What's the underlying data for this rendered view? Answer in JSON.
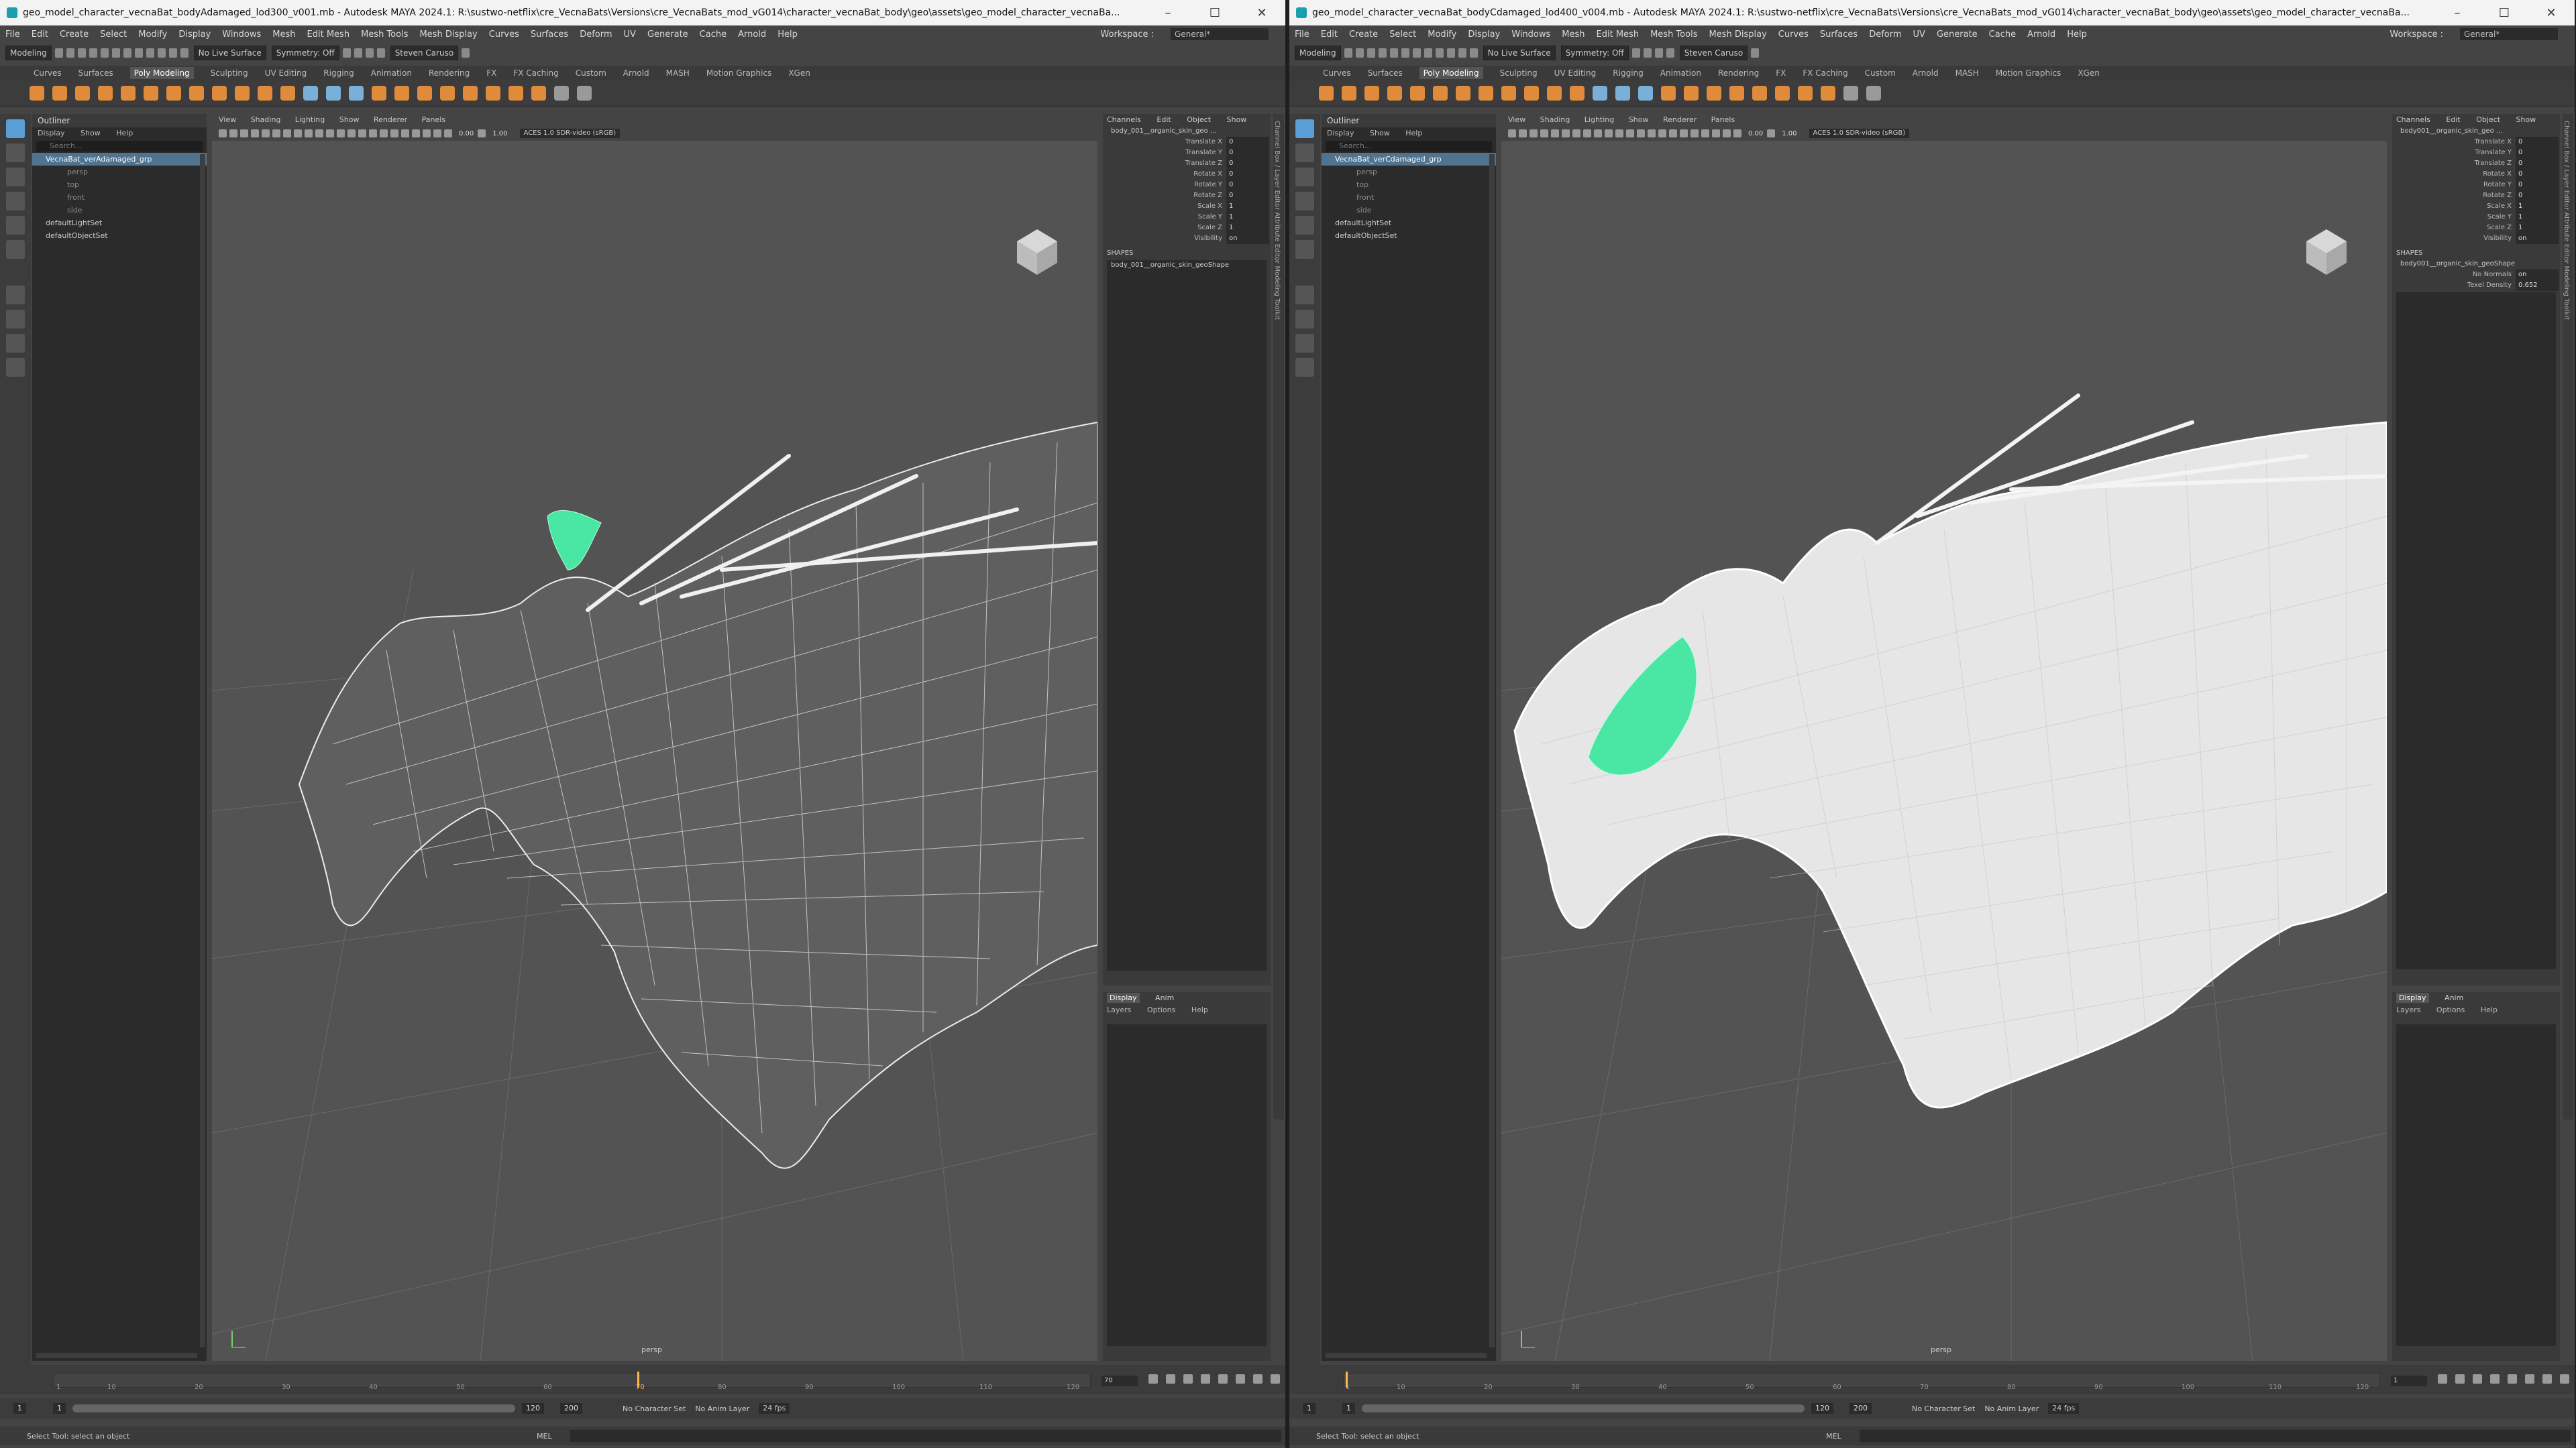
{
  "windows": [
    {
      "id": "left",
      "title": "geo_model_character_vecnaBat_bodyAdamaged_lod300_v001.mb - Autodesk MAYA 2024.1: R:\\sustwo-netflix\\cre_VecnaBats\\Versions\\cre_VecnaBats_mod_vG014\\character_vecnaBat_body\\geo\\assets\\geo_model_character_vecnaBa...",
      "outliner": {
        "title": "Outliner",
        "menu": [
          "Display",
          "Show",
          "Help"
        ],
        "search": "Search...",
        "group": "VecnaBat_verAdamaged_grp",
        "children": [
          "persp",
          "top",
          "front",
          "side"
        ],
        "sets": [
          "defaultLightSet",
          "defaultObjectSet"
        ]
      },
      "channel_box": {
        "node": "body_001__organic_skin_geo ...",
        "shape_name": "body_001__organic_skin_geoShape",
        "attributes": [
          {
            "label": "Translate X",
            "value": "0"
          },
          {
            "label": "Translate Y",
            "value": "0"
          },
          {
            "label": "Translate Z",
            "value": "0"
          },
          {
            "label": "Rotate X",
            "value": "0"
          },
          {
            "label": "Rotate Y",
            "value": "0"
          },
          {
            "label": "Rotate Z",
            "value": "0"
          },
          {
            "label": "Scale X",
            "value": "1"
          },
          {
            "label": "Scale Y",
            "value": "1"
          },
          {
            "label": "Scale Z",
            "value": "1"
          },
          {
            "label": "Visibility",
            "value": "on"
          }
        ],
        "shape_attributes": []
      },
      "highlight_color": "#49e6a4"
    },
    {
      "id": "right",
      "title": "geo_model_character_vecnaBat_bodyCdamaged_lod400_v004.mb - Autodesk MAYA 2024.1: R:\\sustwo-netflix\\cre_VecnaBats\\Versions\\cre_VecnaBats_mod_vG014\\character_vecnaBat_body\\geo\\assets\\geo_model_character_vecnaBa...",
      "outliner": {
        "title": "Outliner",
        "menu": [
          "Display",
          "Show",
          "Help"
        ],
        "search": "Search...",
        "group": "VecnaBat_verCdamaged_grp",
        "children": [
          "persp",
          "top",
          "front",
          "side"
        ],
        "sets": [
          "defaultLightSet",
          "defaultObjectSet"
        ]
      },
      "channel_box": {
        "node": "body001__organic_skin_geo ...",
        "shape_name": "body001__organic_skin_geoShape",
        "attributes": [
          {
            "label": "Translate X",
            "value": "0"
          },
          {
            "label": "Translate Y",
            "value": "0"
          },
          {
            "label": "Translate Z",
            "value": "0"
          },
          {
            "label": "Rotate X",
            "value": "0"
          },
          {
            "label": "Rotate Y",
            "value": "0"
          },
          {
            "label": "Rotate Z",
            "value": "0"
          },
          {
            "label": "Scale X",
            "value": "1"
          },
          {
            "label": "Scale Y",
            "value": "1"
          },
          {
            "label": "Scale Z",
            "value": "1"
          },
          {
            "label": "Visibility",
            "value": "on"
          }
        ],
        "shape_attributes": [
          {
            "label": "No Normals",
            "value": "on"
          },
          {
            "label": "Texel Density",
            "value": "0.652"
          }
        ]
      },
      "highlight_color": "#49e6a4"
    }
  ],
  "common": {
    "menus": [
      "File",
      "Edit",
      "Create",
      "Select",
      "Modify",
      "Display",
      "Windows",
      "Mesh",
      "Edit Mesh",
      "Mesh Tools",
      "Mesh Display",
      "Curves",
      "Surfaces",
      "Deform",
      "UV",
      "Generate",
      "Cache",
      "Arnold",
      "Help"
    ],
    "workspace_label": "Workspace :",
    "workspace_value": "General*",
    "mode": "Modeling",
    "live_surface": "No Live Surface",
    "symmetry": "Symmetry: Off",
    "user": "Steven Caruso",
    "shelf_tabs": [
      "Curves",
      "Surfaces",
      "Poly Modeling",
      "Sculpting",
      "UV Editing",
      "Rigging",
      "Animation",
      "Rendering",
      "FX",
      "FX Caching",
      "Custom",
      "Arnold",
      "MASH",
      "Motion Graphics",
      "XGen"
    ],
    "active_shelf_tab": "Poly Modeling",
    "viewport_menu": [
      "View",
      "Shading",
      "Lighting",
      "Show",
      "Renderer",
      "Panels"
    ],
    "exposure": "0.00",
    "gamma": "1.00",
    "color_space": "ACES 1.0 SDR-video (sRGB)",
    "camera": "persp",
    "channel_box_menu": [
      "Channels",
      "Edit",
      "Object",
      "Show"
    ],
    "shapes_label": "SHAPES",
    "layer_tabs": [
      "Display",
      "Anim"
    ],
    "layer_menu": [
      "Layers",
      "Options",
      "Help"
    ],
    "timeline_ticks": [
      "1",
      "5",
      "10",
      "15",
      "20",
      "25",
      "30",
      "35",
      "40",
      "45",
      "50",
      "55",
      "60",
      "65",
      "70",
      "75",
      "80",
      "85",
      "90",
      "95",
      "100",
      "105",
      "110",
      "115",
      "120"
    ],
    "current_frame": "70",
    "current_frame_marker": "70",
    "range_start": "1",
    "range_start_inner": "1",
    "range_end_inner": "120",
    "range_end": "200",
    "character_set": "No Character Set",
    "anim_layer": "No Anim Layer",
    "fps": "24 fps",
    "mel_label": "MEL",
    "help_line": "Select Tool: select an object",
    "side_tabs": "Channel Box / Layer Editor   Attribute Editor   Modeling Toolkit"
  }
}
